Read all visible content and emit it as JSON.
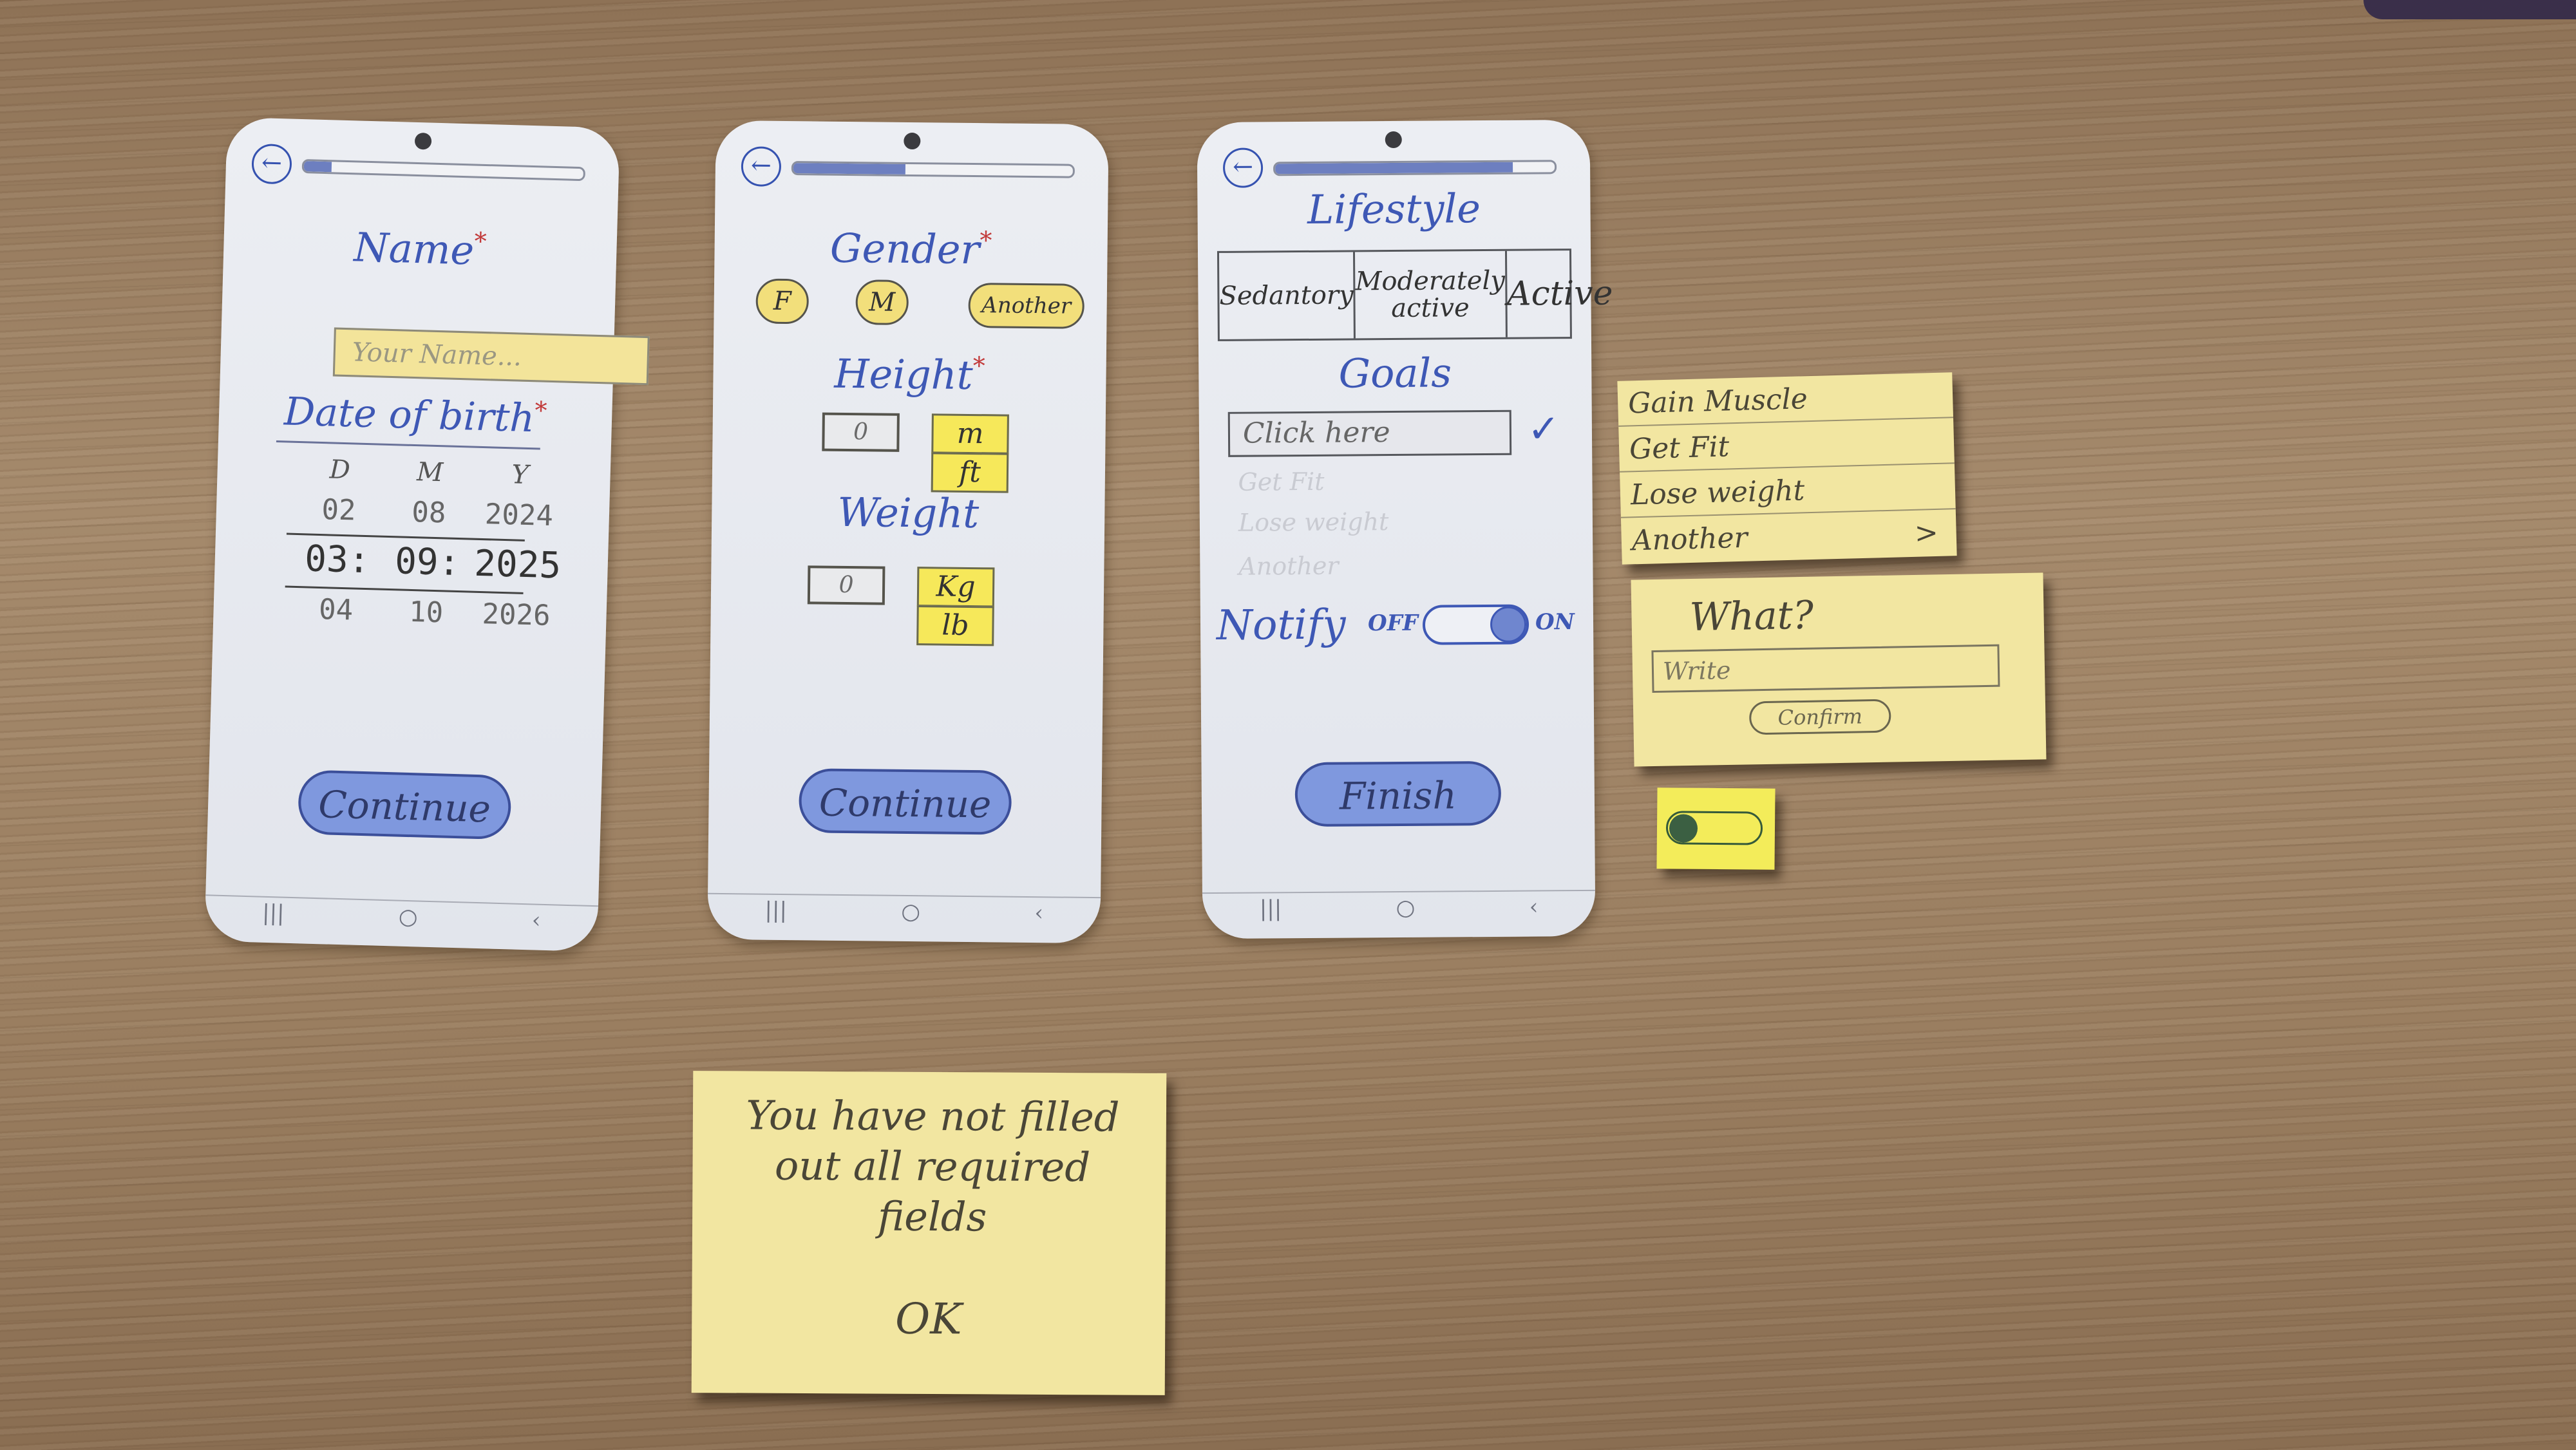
{
  "screen1": {
    "title": "Name",
    "required_mark": "*",
    "name_placeholder": "Your Name...",
    "dob_title": "Date of birth",
    "dob_headers": [
      "D",
      "M",
      "Y"
    ],
    "dob_rows": [
      [
        "02",
        "08",
        "2024"
      ],
      [
        "03:",
        "09:",
        "2025"
      ],
      [
        "04",
        "10",
        "2026"
      ]
    ],
    "continue_label": "Continue",
    "progress": 0.1
  },
  "screen2": {
    "gender_title": "Gender",
    "gender_options": [
      "F",
      "M",
      "Another"
    ],
    "height_title": "Height",
    "height_value": "0",
    "height_units": [
      "m",
      "ft"
    ],
    "weight_title": "Weight",
    "weight_value": "0",
    "weight_units": [
      "Kg",
      "lb"
    ],
    "continue_label": "Continue",
    "progress": 0.4
  },
  "screen3": {
    "lifestyle_title": "Lifestyle",
    "lifestyle_options": [
      "Sedantory",
      "Moderately active",
      "Active"
    ],
    "goals_title": "Goals",
    "goals_placeholder": "Click here",
    "check_glyph": "✓",
    "faded_options": [
      "Get Fit",
      "Lose weight",
      "Another"
    ],
    "notify_label": "Notify",
    "toggle_off": "OFF",
    "toggle_on": "ON",
    "finish_label": "Finish",
    "progress": 0.85
  },
  "navbar": {
    "recent": "|||",
    "home": "○",
    "back": "‹"
  },
  "back_arrow": "←",
  "sticky_goals": {
    "options": [
      "Gain Muscle",
      "Get Fit",
      "Lose weight",
      "Another"
    ],
    "chevron": ">"
  },
  "sticky_what": {
    "title": "What?",
    "input_placeholder": "Write",
    "confirm_label": "Confirm"
  },
  "sticky_error": {
    "message": "You have not filled out all required fields",
    "ok_label": "OK"
  },
  "colors": {
    "accent_blue": "#3e58b5",
    "button_blue": "#7f98de",
    "sticky_yellow": "#f2e6a1",
    "required_red": "#c23a3a"
  },
  "icons": [
    "back-arrow-icon",
    "camera-icon",
    "recent-apps-icon",
    "home-icon",
    "nav-back-icon",
    "check-icon",
    "chevron-right-icon"
  ]
}
